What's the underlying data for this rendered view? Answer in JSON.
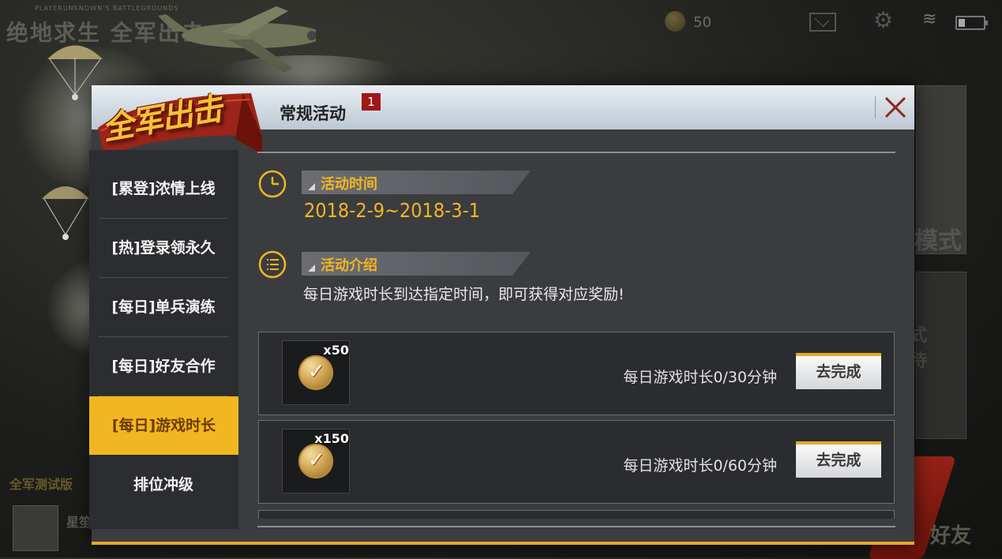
{
  "background": {
    "game_title": "绝地求生 全军出击",
    "game_subtitle": "PLAYERUNKNOWN'S BATTLEGROUNDS",
    "coin_count": "50",
    "mode_label": "模式",
    "mode_placeholder": "式\n待",
    "friends_label": "好友",
    "test_version_label": "全军测试版",
    "player_name": "星笙"
  },
  "logo": {
    "text": "全军出击"
  },
  "dialog": {
    "title": "常规活动",
    "badge_count": "1"
  },
  "sidebar": {
    "items": [
      {
        "label": "[累登]浓情上线",
        "active": false
      },
      {
        "label": "[热]登录领永久",
        "active": false
      },
      {
        "label": "[每日]单兵演练",
        "active": false
      },
      {
        "label": "[每日]好友合作",
        "active": false
      },
      {
        "label": "[每日]游戏时长",
        "active": true
      },
      {
        "label": "排位冲级",
        "active": false
      }
    ]
  },
  "activity": {
    "time_heading": "活动时间",
    "time_range": "2018-2-9~2018-3-1",
    "intro_heading": "活动介绍",
    "intro_text": "每日游戏时长到达指定时间，即可获得对应奖励!"
  },
  "tasks": [
    {
      "reward_qty": "x50",
      "label": "每日游戏时长0/30分钟",
      "button": "去完成"
    },
    {
      "reward_qty": "x150",
      "label": "每日游戏时长0/60分钟",
      "button": "去完成"
    }
  ],
  "colors": {
    "accent": "#f2b620",
    "badge_red": "#a01818",
    "ribbon_red": "#9c2418"
  }
}
